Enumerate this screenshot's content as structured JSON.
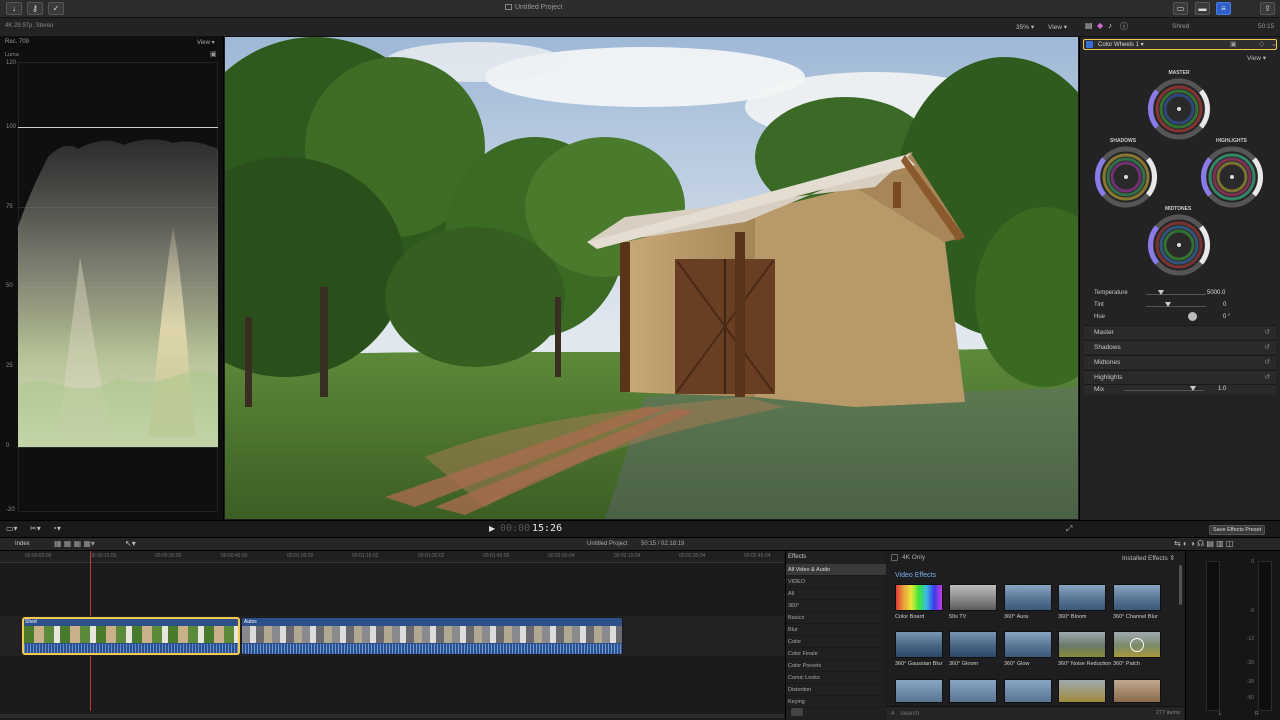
{
  "topbar": {
    "project_title": "Untitled Project",
    "shred_label": "Shred",
    "timecode_right": "50:15"
  },
  "subbar": {
    "format_info": "4K 29.97p, Stereo",
    "zoom_level": "35%",
    "view_label": "View"
  },
  "scope": {
    "colorspace": "Rec. 709",
    "view_label": "View",
    "mode": "Luma",
    "scale": [
      "120",
      "100",
      "75",
      "50",
      "25",
      "0",
      "-20"
    ]
  },
  "inspector": {
    "effect_name": "Color Wheels 1",
    "view_label": "View",
    "wheels": {
      "master": "MASTER",
      "shadows": "SHADOWS",
      "highlights": "HIGHLIGHTS",
      "midtones": "MIDTONES"
    },
    "temperature_label": "Temperature",
    "temperature_value": "5000.0",
    "tint_label": "Tint",
    "tint_value": "0",
    "hue_label": "Hue",
    "hue_value": "0 °",
    "sections": [
      "Master",
      "Shadows",
      "Midtones",
      "Highlights"
    ],
    "mix_label": "Mix",
    "mix_value": "1.0"
  },
  "playbar": {
    "timecode_dim": "00:00",
    "timecode": "15:26",
    "save_preset": "Save Effects Preset"
  },
  "timeline_header": {
    "index_label": "Index",
    "project_title": "Untitled Project",
    "duration": "50:15 / 02:18:19"
  },
  "ruler": [
    "00:00:00:00",
    "00:00:15:00",
    "00:00:30:00",
    "00:00:45:00",
    "00:01:00:02",
    "00:01:15:02",
    "00:01:30:02",
    "00:01:45:03",
    "00:02:00:04",
    "00:02:15:04",
    "00:02:30:04",
    "00:02:45:04"
  ],
  "clips": [
    {
      "name": "Shed"
    },
    {
      "name": "Autos"
    }
  ],
  "effects": {
    "header": "Effects",
    "four_k_only": "4K Only",
    "installed": "Installed Effects",
    "section_title": "Video Effects",
    "categories": [
      "All Video & Audio",
      "VIDEO",
      "All",
      "360°",
      "Basics",
      "Blur",
      "Color",
      "Color Finale",
      "Color Presets",
      "Comic Looks",
      "Distortion",
      "Keying"
    ],
    "items": [
      {
        "name": "Color Board"
      },
      {
        "name": "50s TV"
      },
      {
        "name": "360° Aura"
      },
      {
        "name": "360° Bloom"
      },
      {
        "name": "360° Channel Blur"
      },
      {
        "name": "360° Gaussian Blur"
      },
      {
        "name": "360° Gloom"
      },
      {
        "name": "360° Glow"
      },
      {
        "name": "360° Noise Reduction"
      },
      {
        "name": "360° Patch"
      }
    ],
    "search_placeholder": "Search",
    "item_count": "277 items"
  },
  "meters": {
    "scale": [
      "0",
      "-6",
      "-12",
      "-20",
      "-30",
      "-50"
    ],
    "left": "L",
    "right": "R"
  },
  "colors": {
    "accent": "#f2c94c",
    "clip_selected_border": "#f2c94c",
    "clip_audio": "#2d4f8a",
    "active_tool": "#3a6fd8"
  }
}
